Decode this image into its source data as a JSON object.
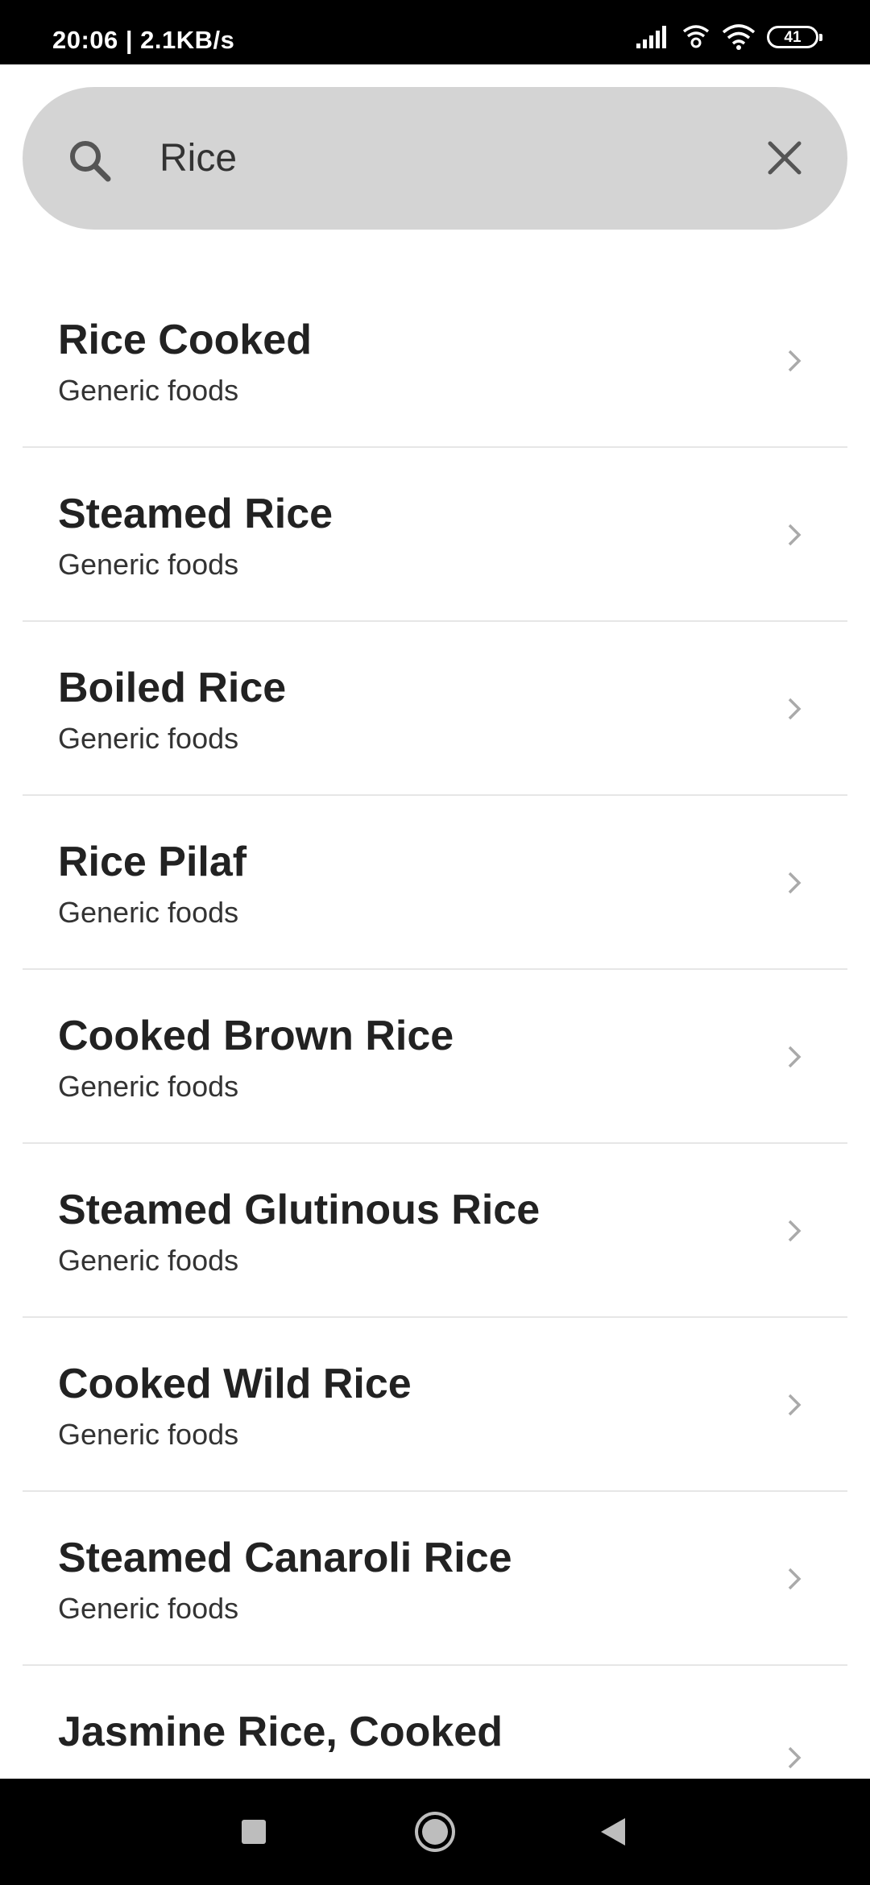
{
  "status_bar": {
    "time": "20:06 | 2.1KB/s",
    "battery": "41"
  },
  "search": {
    "query": "Rice",
    "icon": "search-icon",
    "clear_icon": "close-icon"
  },
  "results": [
    {
      "title": "Rice Cooked",
      "subtitle": "Generic foods"
    },
    {
      "title": "Steamed Rice",
      "subtitle": "Generic foods"
    },
    {
      "title": "Boiled Rice",
      "subtitle": "Generic foods"
    },
    {
      "title": "Rice Pilaf",
      "subtitle": "Generic foods"
    },
    {
      "title": "Cooked Brown Rice",
      "subtitle": "Generic foods"
    },
    {
      "title": "Steamed Glutinous Rice",
      "subtitle": "Generic foods"
    },
    {
      "title": "Cooked Wild Rice",
      "subtitle": "Generic foods"
    },
    {
      "title": "Steamed Canaroli Rice",
      "subtitle": "Generic foods"
    },
    {
      "title": "Jasmine Rice, Cooked",
      "subtitle": ""
    }
  ],
  "colors": {
    "search_bg": "#d4d4d4",
    "text": "#222222",
    "divider": "#e6e6e6",
    "chevron": "#aaaaaa"
  }
}
